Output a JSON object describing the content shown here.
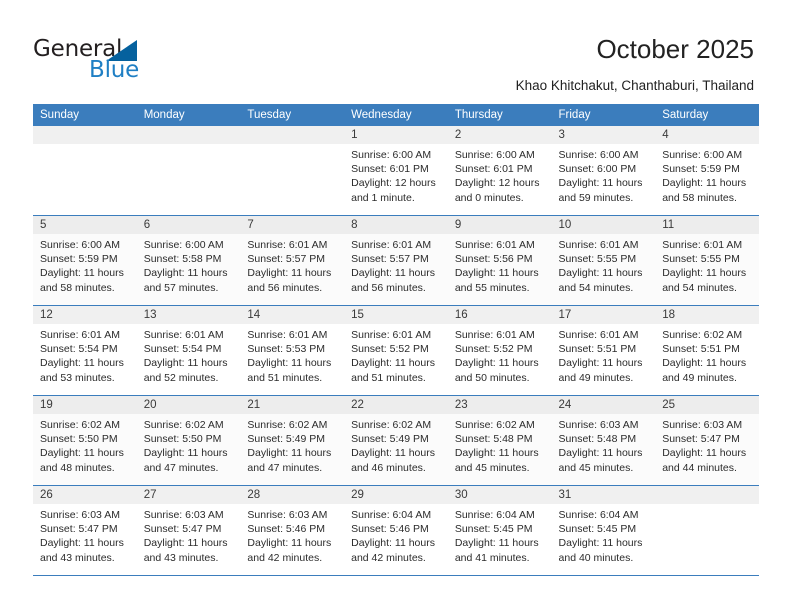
{
  "brand": {
    "name_dark": "General",
    "name_light": "Blue",
    "color_dark": "#231f20",
    "color_light": "#1f7fc4",
    "triangle_color": "#05619e"
  },
  "header": {
    "title": "October 2025",
    "subtitle": "Khao Khitchakut, Chanthaburi, Thailand"
  },
  "theme": {
    "header_bg": "#3b7dbd",
    "header_text": "#ffffff",
    "daynum_bg": "#f0f0f0",
    "row_alt_bg": "#fbfbfb"
  },
  "weekdays": [
    "Sunday",
    "Monday",
    "Tuesday",
    "Wednesday",
    "Thursday",
    "Friday",
    "Saturday"
  ],
  "weeks": [
    [
      {
        "day": "",
        "sunrise": "",
        "sunset": "",
        "daylight1": "",
        "daylight2": ""
      },
      {
        "day": "",
        "sunrise": "",
        "sunset": "",
        "daylight1": "",
        "daylight2": ""
      },
      {
        "day": "",
        "sunrise": "",
        "sunset": "",
        "daylight1": "",
        "daylight2": ""
      },
      {
        "day": "1",
        "sunrise": "Sunrise: 6:00 AM",
        "sunset": "Sunset: 6:01 PM",
        "daylight1": "Daylight: 12 hours",
        "daylight2": "and 1 minute."
      },
      {
        "day": "2",
        "sunrise": "Sunrise: 6:00 AM",
        "sunset": "Sunset: 6:01 PM",
        "daylight1": "Daylight: 12 hours",
        "daylight2": "and 0 minutes."
      },
      {
        "day": "3",
        "sunrise": "Sunrise: 6:00 AM",
        "sunset": "Sunset: 6:00 PM",
        "daylight1": "Daylight: 11 hours",
        "daylight2": "and 59 minutes."
      },
      {
        "day": "4",
        "sunrise": "Sunrise: 6:00 AM",
        "sunset": "Sunset: 5:59 PM",
        "daylight1": "Daylight: 11 hours",
        "daylight2": "and 58 minutes."
      }
    ],
    [
      {
        "day": "5",
        "sunrise": "Sunrise: 6:00 AM",
        "sunset": "Sunset: 5:59 PM",
        "daylight1": "Daylight: 11 hours",
        "daylight2": "and 58 minutes."
      },
      {
        "day": "6",
        "sunrise": "Sunrise: 6:00 AM",
        "sunset": "Sunset: 5:58 PM",
        "daylight1": "Daylight: 11 hours",
        "daylight2": "and 57 minutes."
      },
      {
        "day": "7",
        "sunrise": "Sunrise: 6:01 AM",
        "sunset": "Sunset: 5:57 PM",
        "daylight1": "Daylight: 11 hours",
        "daylight2": "and 56 minutes."
      },
      {
        "day": "8",
        "sunrise": "Sunrise: 6:01 AM",
        "sunset": "Sunset: 5:57 PM",
        "daylight1": "Daylight: 11 hours",
        "daylight2": "and 56 minutes."
      },
      {
        "day": "9",
        "sunrise": "Sunrise: 6:01 AM",
        "sunset": "Sunset: 5:56 PM",
        "daylight1": "Daylight: 11 hours",
        "daylight2": "and 55 minutes."
      },
      {
        "day": "10",
        "sunrise": "Sunrise: 6:01 AM",
        "sunset": "Sunset: 5:55 PM",
        "daylight1": "Daylight: 11 hours",
        "daylight2": "and 54 minutes."
      },
      {
        "day": "11",
        "sunrise": "Sunrise: 6:01 AM",
        "sunset": "Sunset: 5:55 PM",
        "daylight1": "Daylight: 11 hours",
        "daylight2": "and 54 minutes."
      }
    ],
    [
      {
        "day": "12",
        "sunrise": "Sunrise: 6:01 AM",
        "sunset": "Sunset: 5:54 PM",
        "daylight1": "Daylight: 11 hours",
        "daylight2": "and 53 minutes."
      },
      {
        "day": "13",
        "sunrise": "Sunrise: 6:01 AM",
        "sunset": "Sunset: 5:54 PM",
        "daylight1": "Daylight: 11 hours",
        "daylight2": "and 52 minutes."
      },
      {
        "day": "14",
        "sunrise": "Sunrise: 6:01 AM",
        "sunset": "Sunset: 5:53 PM",
        "daylight1": "Daylight: 11 hours",
        "daylight2": "and 51 minutes."
      },
      {
        "day": "15",
        "sunrise": "Sunrise: 6:01 AM",
        "sunset": "Sunset: 5:52 PM",
        "daylight1": "Daylight: 11 hours",
        "daylight2": "and 51 minutes."
      },
      {
        "day": "16",
        "sunrise": "Sunrise: 6:01 AM",
        "sunset": "Sunset: 5:52 PM",
        "daylight1": "Daylight: 11 hours",
        "daylight2": "and 50 minutes."
      },
      {
        "day": "17",
        "sunrise": "Sunrise: 6:01 AM",
        "sunset": "Sunset: 5:51 PM",
        "daylight1": "Daylight: 11 hours",
        "daylight2": "and 49 minutes."
      },
      {
        "day": "18",
        "sunrise": "Sunrise: 6:02 AM",
        "sunset": "Sunset: 5:51 PM",
        "daylight1": "Daylight: 11 hours",
        "daylight2": "and 49 minutes."
      }
    ],
    [
      {
        "day": "19",
        "sunrise": "Sunrise: 6:02 AM",
        "sunset": "Sunset: 5:50 PM",
        "daylight1": "Daylight: 11 hours",
        "daylight2": "and 48 minutes."
      },
      {
        "day": "20",
        "sunrise": "Sunrise: 6:02 AM",
        "sunset": "Sunset: 5:50 PM",
        "daylight1": "Daylight: 11 hours",
        "daylight2": "and 47 minutes."
      },
      {
        "day": "21",
        "sunrise": "Sunrise: 6:02 AM",
        "sunset": "Sunset: 5:49 PM",
        "daylight1": "Daylight: 11 hours",
        "daylight2": "and 47 minutes."
      },
      {
        "day": "22",
        "sunrise": "Sunrise: 6:02 AM",
        "sunset": "Sunset: 5:49 PM",
        "daylight1": "Daylight: 11 hours",
        "daylight2": "and 46 minutes."
      },
      {
        "day": "23",
        "sunrise": "Sunrise: 6:02 AM",
        "sunset": "Sunset: 5:48 PM",
        "daylight1": "Daylight: 11 hours",
        "daylight2": "and 45 minutes."
      },
      {
        "day": "24",
        "sunrise": "Sunrise: 6:03 AM",
        "sunset": "Sunset: 5:48 PM",
        "daylight1": "Daylight: 11 hours",
        "daylight2": "and 45 minutes."
      },
      {
        "day": "25",
        "sunrise": "Sunrise: 6:03 AM",
        "sunset": "Sunset: 5:47 PM",
        "daylight1": "Daylight: 11 hours",
        "daylight2": "and 44 minutes."
      }
    ],
    [
      {
        "day": "26",
        "sunrise": "Sunrise: 6:03 AM",
        "sunset": "Sunset: 5:47 PM",
        "daylight1": "Daylight: 11 hours",
        "daylight2": "and 43 minutes."
      },
      {
        "day": "27",
        "sunrise": "Sunrise: 6:03 AM",
        "sunset": "Sunset: 5:47 PM",
        "daylight1": "Daylight: 11 hours",
        "daylight2": "and 43 minutes."
      },
      {
        "day": "28",
        "sunrise": "Sunrise: 6:03 AM",
        "sunset": "Sunset: 5:46 PM",
        "daylight1": "Daylight: 11 hours",
        "daylight2": "and 42 minutes."
      },
      {
        "day": "29",
        "sunrise": "Sunrise: 6:04 AM",
        "sunset": "Sunset: 5:46 PM",
        "daylight1": "Daylight: 11 hours",
        "daylight2": "and 42 minutes."
      },
      {
        "day": "30",
        "sunrise": "Sunrise: 6:04 AM",
        "sunset": "Sunset: 5:45 PM",
        "daylight1": "Daylight: 11 hours",
        "daylight2": "and 41 minutes."
      },
      {
        "day": "31",
        "sunrise": "Sunrise: 6:04 AM",
        "sunset": "Sunset: 5:45 PM",
        "daylight1": "Daylight: 11 hours",
        "daylight2": "and 40 minutes."
      },
      {
        "day": "",
        "sunrise": "",
        "sunset": "",
        "daylight1": "",
        "daylight2": ""
      }
    ]
  ]
}
